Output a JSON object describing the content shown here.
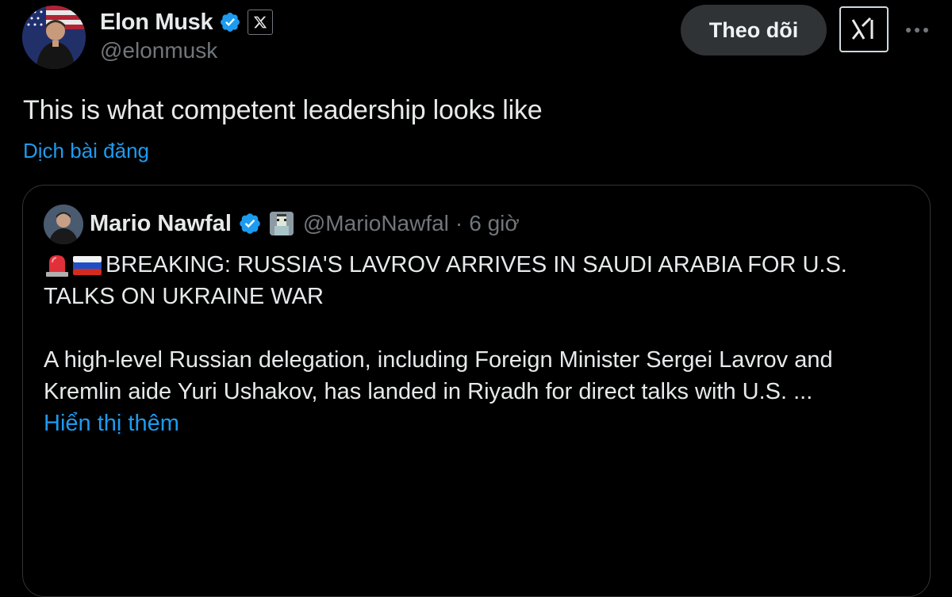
{
  "post": {
    "author": {
      "display_name": "Elon Musk",
      "handle": "@elonmusk",
      "verified": true,
      "affiliate_badge": "x-logo-icon"
    },
    "follow_label": "Theo dõi",
    "text": "This is what competent leadership looks like",
    "translate_label": "Dịch bài đăng"
  },
  "quoted_post": {
    "author": {
      "display_name": "Mario Nawfal",
      "handle": "@MarioNawfal",
      "verified": true,
      "affiliate_badge": "pixel-avatar-icon"
    },
    "separator": "·",
    "time": "6 giờ",
    "headline": "BREAKING: RUSSIA'S LAVROV ARRIVES IN SAUDI ARABIA FOR U.S.",
    "headline_line2": "TALKS ON UKRAINE WAR",
    "headline_emojis": [
      "siren-emoji",
      "russia-flag-emoji"
    ],
    "body_line1": "A high-level Russian delegation, including Foreign Minister Sergei Lavrov and",
    "body_line2": "Kremlin aide Yuri Ushakov, has landed in Riyadh for direct talks with U.S. ...",
    "show_more_label": "Hiển thị thêm"
  },
  "colors": {
    "background": "#000000",
    "text_primary": "#e7e9ea",
    "text_secondary": "#71767b",
    "link": "#1d9bf0",
    "verified": "#1d9bf0",
    "button_bg": "#2f3336",
    "border": "#2f3336"
  }
}
